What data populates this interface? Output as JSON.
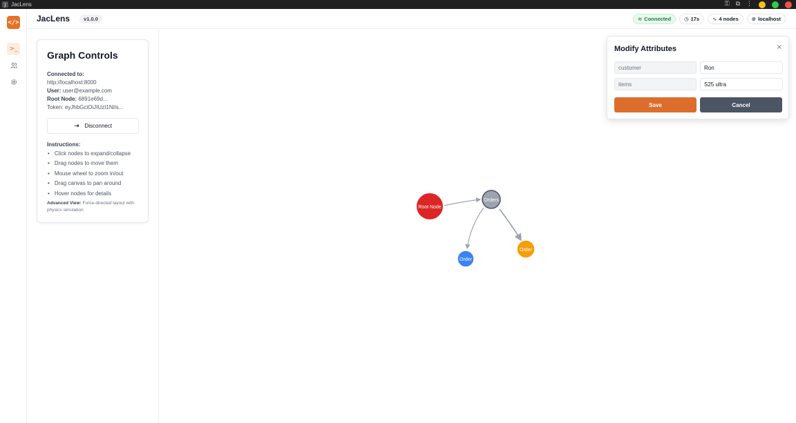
{
  "window": {
    "title": "JacLens",
    "app_icon_glyph": "J",
    "colors": {
      "titlebar": "#1f1f1f",
      "min": "#f5c018",
      "max": "#2ecc48",
      "close": "#f0504a"
    }
  },
  "header": {
    "brand": "JacLens",
    "version": "v1.0.0",
    "status": {
      "connected": "Connected",
      "uptime": "17s",
      "nodes": "4 nodes",
      "host": "localhost"
    }
  },
  "rail": {
    "logo": "</>",
    "items": [
      "terminal-icon",
      "users-icon",
      "settings-icon"
    ]
  },
  "controls": {
    "title": "Graph Controls",
    "connected_to_label": "Connected to:",
    "url": "http://localhost:8000",
    "user_label": "User:",
    "user": "user@example.com",
    "root_label": "Root Node:",
    "root": "6891e69d...",
    "token_label": "Token:",
    "token": "eyJhbGciOiJIUzI1NiIs...",
    "disconnect": "Disconnect",
    "instructions_label": "Instructions:",
    "instructions": [
      "Click nodes to expand/collapse",
      "Drag nodes to move them",
      "Mouse wheel to zoom in/out",
      "Drag canvas to pan around",
      "Hover nodes for details"
    ],
    "advanced_label": "Advanced View:",
    "advanced_text": "Force-directed layout with physics simulation"
  },
  "graph": {
    "nodes": [
      {
        "label": "Root Node",
        "color": "#dc2626"
      },
      {
        "label": "Orders",
        "color": "#9ca3af"
      },
      {
        "label": "Order",
        "color": "#3b82f6"
      },
      {
        "label": "Order",
        "color": "#f59e0b"
      }
    ]
  },
  "modal": {
    "title": "Modify Attributes",
    "close": "×",
    "attributes": [
      {
        "key": "customer",
        "value": "Ron"
      },
      {
        "key": "items",
        "value": "S25 ultra"
      }
    ],
    "save": "Save",
    "cancel": "Cancel",
    "colors": {
      "save": "#dd6d2c",
      "cancel": "#4b5563"
    }
  }
}
